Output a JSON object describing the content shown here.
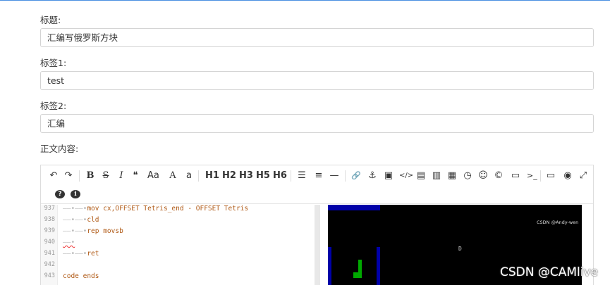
{
  "form": {
    "title_label": "标题:",
    "title_value": "汇编写俄罗斯方块",
    "tag1_label": "标签1:",
    "tag1_value": "test",
    "tag2_label": "标签2:",
    "tag2_value": "汇编",
    "content_label": "正文内容:"
  },
  "toolbar": {
    "undo": "↶",
    "redo": "↷",
    "bold": "B",
    "strike": "S",
    "italic": "I",
    "quote": "❝",
    "uppercase": "Aa",
    "uppercase_a": "A",
    "lowercase_a": "a",
    "h1": "H1",
    "h2": "H2",
    "h3": "H3",
    "h5": "H5",
    "h6": "H6",
    "ul": "☰",
    "ol": "≡",
    "hr": "—",
    "link": "🔗",
    "anchor": "⚓",
    "image": "▣",
    "code": "</>",
    "code_block": "▤",
    "preformatted": "▥",
    "table": "▦",
    "datetime": "◷",
    "emoji": "☺",
    "html_entity": "©",
    "pagebreak": "▭",
    "terminal": ">_",
    "watch": "▭",
    "preview": "◉",
    "fullscreen": "⤢",
    "help": "?",
    "info": "i"
  },
  "code": {
    "lines": [
      {
        "num": "937",
        "tabs": "——•——•",
        "text": "mov cx,OFFSET Tetris_end - OFFSET Tetris"
      },
      {
        "num": "938",
        "tabs": "——•——•",
        "text": "cld"
      },
      {
        "num": "939",
        "tabs": "——•——•",
        "text": "rep movsb"
      },
      {
        "num": "940",
        "tabs": "——•",
        "text": ""
      },
      {
        "num": "941",
        "tabs": "——•——•",
        "text": "ret"
      },
      {
        "num": "942",
        "tabs": "",
        "text": ""
      },
      {
        "num": "943",
        "tabs": "",
        "text": "code ends"
      }
    ]
  },
  "preview": {
    "watermark_small": "CSDN @Andy-wen",
    "cursor_char": "D"
  },
  "watermark": "CSDN @CAMlive",
  "colors": {
    "accent": "#4a90e2",
    "code_text": "#b05a16",
    "dos_blue": "#0000a8",
    "dos_green": "#00a800"
  }
}
